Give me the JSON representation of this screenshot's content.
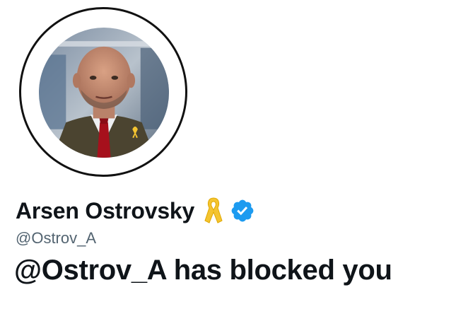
{
  "profile": {
    "display_name": "Arsen Ostrovsky",
    "handle": "@Ostrov_A",
    "badges": [
      "yellow-ribbon-icon",
      "verified-badge-icon"
    ],
    "avatar_description": "profile photo"
  },
  "message": {
    "blocked_text": "@Ostrov_A has blocked you"
  },
  "colors": {
    "text_primary": "#0f1419",
    "text_secondary": "#536471",
    "verified_blue": "#1d9bf0",
    "ribbon_yellow": "#f4c430",
    "background": "#ffffff"
  }
}
